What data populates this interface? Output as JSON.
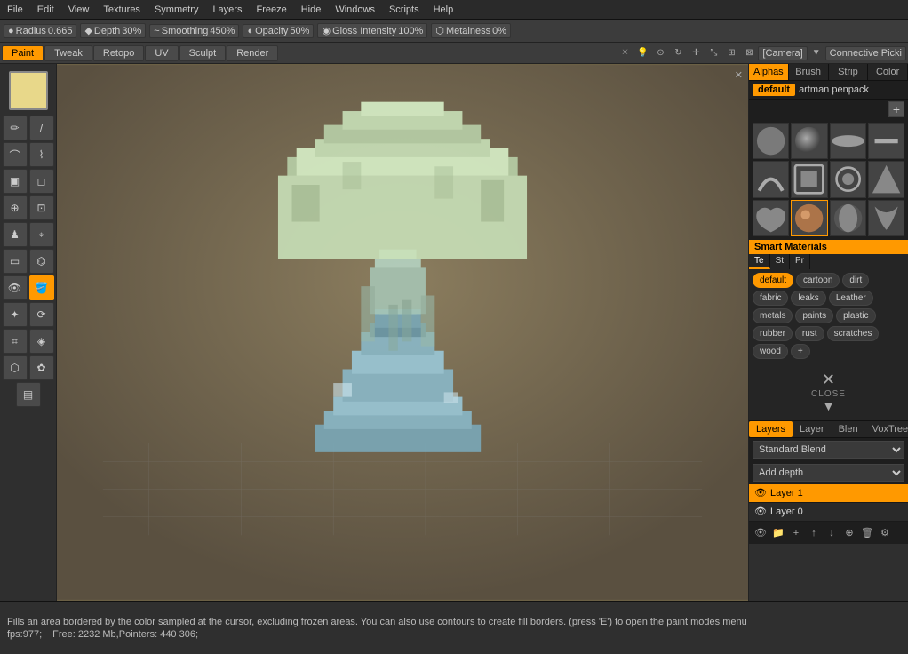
{
  "menu": {
    "items": [
      "File",
      "Edit",
      "View",
      "Textures",
      "Symmetry",
      "Layers",
      "Freeze",
      "Hide",
      "Windows",
      "Scripts",
      "Help"
    ]
  },
  "toolbar1": {
    "radius_label": "Radius",
    "radius_value": "0.665",
    "depth_label": "Depth",
    "depth_value": "30%",
    "smoothing_label": "Smoothing",
    "smoothing_value": "450%",
    "opacity_label": "Opacity",
    "opacity_value": "50%",
    "gloss_label": "Gloss Intensity",
    "gloss_value": "100%",
    "metalness_label": "Metalness",
    "metalness_value": "0%"
  },
  "tabs2": {
    "items": [
      "Paint",
      "Tweak",
      "Retopo",
      "UV",
      "Sculpt",
      "Render"
    ]
  },
  "workspace": {
    "camera": "[Camera]",
    "connective": "Connective Picki"
  },
  "right_panel": {
    "tabs": [
      "Alphas",
      "Brush",
      "Strip",
      "Color"
    ],
    "default_label": "default",
    "artman_label": "artman penpack",
    "smart_materials_label": "Smart Materials",
    "smart_mat_tabs": [
      "Te",
      "St",
      "Pr"
    ],
    "mat_tags": [
      "default",
      "cartoon",
      "dirt",
      "fabric",
      "leaks",
      "Leather",
      "metals",
      "paints",
      "plastic",
      "rubber",
      "rust",
      "scratches",
      "wood"
    ],
    "active_tag": "default",
    "close_label": "CLOSE",
    "layers_tabs": [
      "Layers",
      "Layer",
      "Blen",
      "VoxTree"
    ],
    "blend_label": "Standard Blend",
    "depth_label": "Add depth",
    "layers": [
      {
        "name": "Layer 1",
        "active": true
      },
      {
        "name": "Layer 0",
        "active": false
      }
    ]
  },
  "status": {
    "message": "Fills an area bordered by the color sampled at the cursor, excluding frozen areas. You can also use contours to create fill borders. (press 'E') to open the paint modes menu",
    "fps": "fps:977;",
    "free": "Free: 2232 Mb,Pointers: 440 306;"
  }
}
